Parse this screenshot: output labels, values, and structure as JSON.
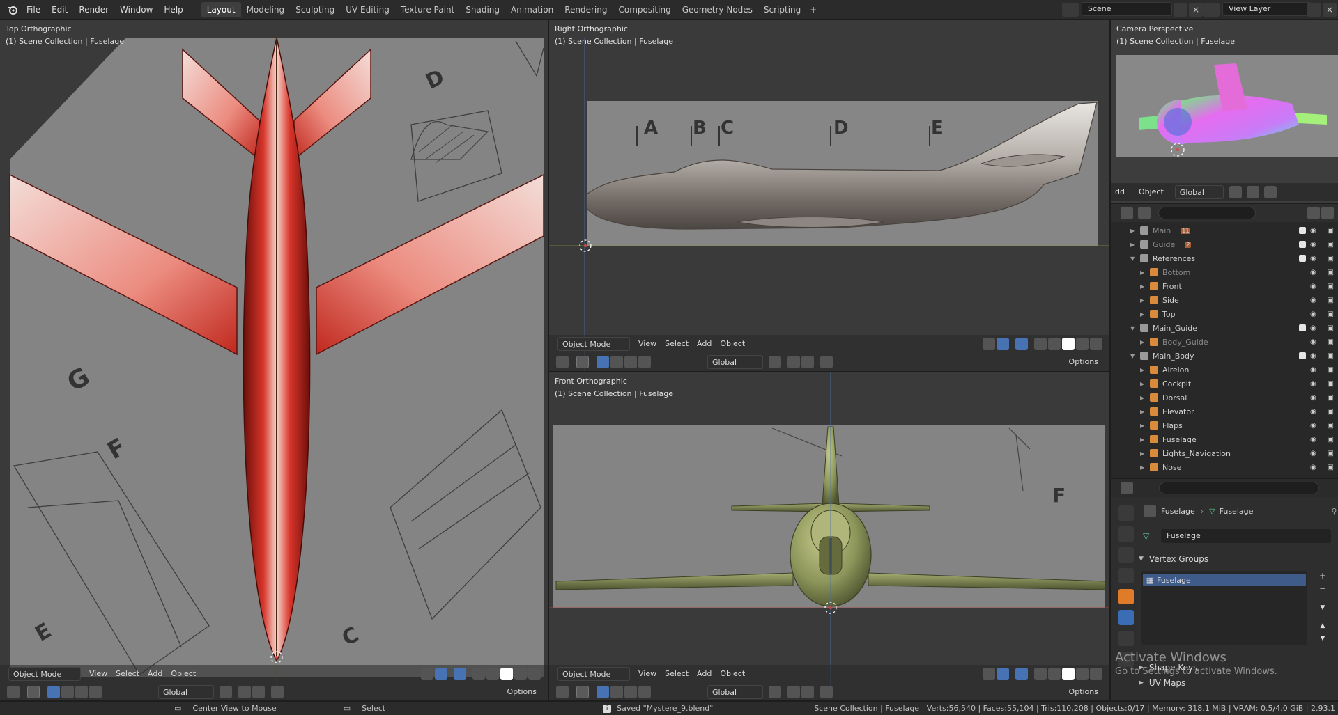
{
  "menu": [
    "File",
    "Edit",
    "Render",
    "Window",
    "Help"
  ],
  "workspace_tabs": [
    "Layout",
    "Modeling",
    "Sculpting",
    "UV Editing",
    "Texture Paint",
    "Shading",
    "Animation",
    "Rendering",
    "Compositing",
    "Geometry Nodes",
    "Scripting"
  ],
  "active_tab": "Layout",
  "scene": "Scene",
  "view_layer": "View Layer",
  "viewports": {
    "top": {
      "label": "Top Orthographic",
      "sub": "(1) Scene Collection | Fuselage"
    },
    "right": {
      "label": "Right Orthographic",
      "sub": "(1) Scene Collection | Fuselage"
    },
    "front": {
      "label": "Front Orthographic",
      "sub": "(1) Scene Collection | Fuselage"
    },
    "camera": {
      "label": "Camera Perspective",
      "sub": "(1) Scene Collection | Fuselage"
    }
  },
  "header": {
    "mode": "Object Mode",
    "view": "View",
    "select": "Select",
    "add": "Add",
    "object": "Object",
    "orientation": "Global",
    "options": "Options",
    "camera_add": "dd",
    "camera_object": "Object"
  },
  "blueprint_letters": {
    "right": [
      "A",
      "B",
      "C",
      "D",
      "E"
    ],
    "front": [
      "F"
    ],
    "top": [
      "D",
      "G",
      "F",
      "C",
      "E"
    ]
  },
  "outliner": [
    {
      "name": "Main",
      "level": 1,
      "dim": true,
      "badge": "11"
    },
    {
      "name": "Guide",
      "level": 1,
      "dim": true,
      "badge": "2"
    },
    {
      "name": "References",
      "level": 1,
      "dim": false
    },
    {
      "name": "Bottom",
      "level": 2,
      "dim": true
    },
    {
      "name": "Front",
      "level": 2,
      "dim": false
    },
    {
      "name": "Side",
      "level": 2,
      "dim": false
    },
    {
      "name": "Top",
      "level": 2,
      "dim": false
    },
    {
      "name": "Main_Guide",
      "level": 1,
      "dim": false
    },
    {
      "name": "Body_Guide",
      "level": 2,
      "dim": true
    },
    {
      "name": "Main_Body",
      "level": 1,
      "dim": false
    },
    {
      "name": "Airelon",
      "level": 2,
      "dim": false
    },
    {
      "name": "Cockpit",
      "level": 2,
      "dim": false
    },
    {
      "name": "Dorsal",
      "level": 2,
      "dim": false
    },
    {
      "name": "Elevator",
      "level": 2,
      "dim": false
    },
    {
      "name": "Flaps",
      "level": 2,
      "dim": false
    },
    {
      "name": "Fuselage",
      "level": 2,
      "dim": false
    },
    {
      "name": "Lights_Navigation",
      "level": 2,
      "dim": false
    },
    {
      "name": "Nose",
      "level": 2,
      "dim": false
    }
  ],
  "properties": {
    "object_name": "Fuselage",
    "mesh_name": "Fuselage",
    "data_name": "Fuselage",
    "vertex_groups_title": "Vertex Groups",
    "vertex_group": "Fuselage",
    "shape_keys": "Shape Keys",
    "uv_maps": "UV Maps"
  },
  "watermark": {
    "title": "Activate Windows",
    "sub": "Go to Settings to activate Windows."
  },
  "status": {
    "hint1": "Center View to Mouse",
    "hint2": "Select",
    "saved": "Saved \"Mystere_9.blend\"",
    "stats": "Scene Collection | Fuselage | Verts:56,540 | Faces:55,104 | Tris:110,208 | Objects:0/17 | Memory: 318.1 MiB | VRAM: 0.5/4.0 GiB | 2.93.1"
  },
  "colors": {
    "accent": "#4772b3",
    "fuselage_red": "#c0281e",
    "fuselage_side": "#b8b3ad",
    "fuselage_front": "#8c955a"
  }
}
